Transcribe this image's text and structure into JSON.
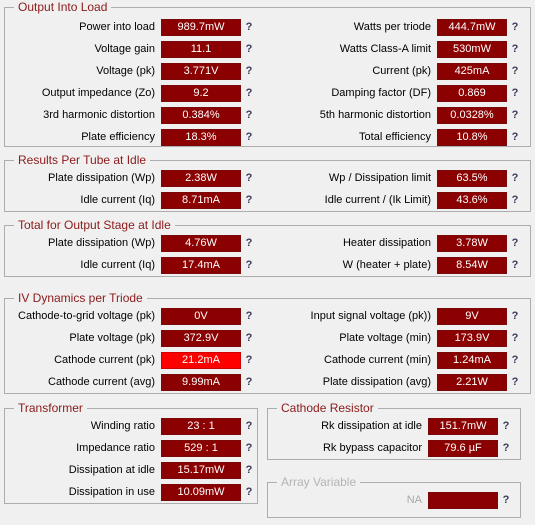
{
  "app": {
    "help_glyph": "?",
    "accent_color": "#8b1a1a",
    "value_bg": "#8b0000",
    "value_alert_bg": "#ff0000",
    "background": "#f0f0f0"
  },
  "sections": {
    "output_into_load": {
      "title": "Output Into Load",
      "left": [
        {
          "label": "Power into load",
          "value": "989.7mW"
        },
        {
          "label": "Voltage gain",
          "value": "11.1"
        },
        {
          "label": "Voltage (pk)",
          "value": "3.771V"
        },
        {
          "label": "Output impedance (Zo)",
          "value": "9.2"
        },
        {
          "label": "3rd harmonic distortion",
          "value": "0.384%"
        },
        {
          "label": "Plate efficiency",
          "value": "18.3%"
        }
      ],
      "right": [
        {
          "label": "Watts per triode",
          "value": "444.7mW"
        },
        {
          "label": "Watts Class-A limit",
          "value": "530mW"
        },
        {
          "label": "Current (pk)",
          "value": "425mA"
        },
        {
          "label": "Damping factor (DF)",
          "value": "0.869"
        },
        {
          "label": "5th harmonic distortion",
          "value": "0.0328%"
        },
        {
          "label": "Total efficiency",
          "value": "10.8%"
        }
      ]
    },
    "results_per_tube_at_idle": {
      "title": "Results Per Tube at Idle",
      "left": [
        {
          "label": "Plate dissipation (Wp)",
          "value": "2.38W"
        },
        {
          "label": "Idle current (Iq)",
          "value": "8.71mA"
        }
      ],
      "right": [
        {
          "label": "Wp / Dissipation limit",
          "value": "63.5%"
        },
        {
          "label": "Idle current / (Ik Limit)",
          "value": "43.6%"
        }
      ]
    },
    "total_for_output_stage_at_idle": {
      "title": "Total for Output Stage at Idle",
      "left": [
        {
          "label": "Plate dissipation (Wp)",
          "value": "4.76W"
        },
        {
          "label": "Idle current (Iq)",
          "value": "17.4mA"
        }
      ],
      "right": [
        {
          "label": "Heater dissipation",
          "value": "3.78W"
        },
        {
          "label": "W (heater + plate)",
          "value": "8.54W"
        }
      ]
    },
    "iv_dynamics_per_triode": {
      "title": "IV Dynamics per Triode",
      "left": [
        {
          "label": "Cathode-to-grid voltage (pk)",
          "value": "0V"
        },
        {
          "label": "Plate voltage (pk)",
          "value": "372.9V"
        },
        {
          "label": "Cathode current (pk)",
          "value": "21.2mA",
          "alert": true
        },
        {
          "label": "Cathode current (avg)",
          "value": "9.99mA"
        }
      ],
      "right": [
        {
          "label": "Input signal voltage (pk))",
          "value": "9V"
        },
        {
          "label": "Plate voltage (min)",
          "value": "173.9V"
        },
        {
          "label": "Cathode current (min)",
          "value": "1.24mA"
        },
        {
          "label": "Plate dissipation (avg)",
          "value": "2.21W"
        }
      ]
    },
    "transformer": {
      "title": "Transformer",
      "rows": [
        {
          "label": "Winding ratio",
          "value": "23 : 1"
        },
        {
          "label": "Impedance ratio",
          "value": "529 : 1"
        },
        {
          "label": "Dissipation at idle",
          "value": "15.17mW"
        },
        {
          "label": "Dissipation in use",
          "value": "10.09mW"
        }
      ]
    },
    "cathode_resistor": {
      "title": "Cathode Resistor",
      "rows": [
        {
          "label": "Rk dissipation at idle",
          "value": "151.7mW"
        },
        {
          "label": "Rk bypass capacitor",
          "value": "79.6 µF"
        }
      ]
    },
    "array_variable": {
      "title": "Array Variable",
      "disabled": true,
      "rows": [
        {
          "label": "NA",
          "value": ""
        }
      ]
    }
  }
}
